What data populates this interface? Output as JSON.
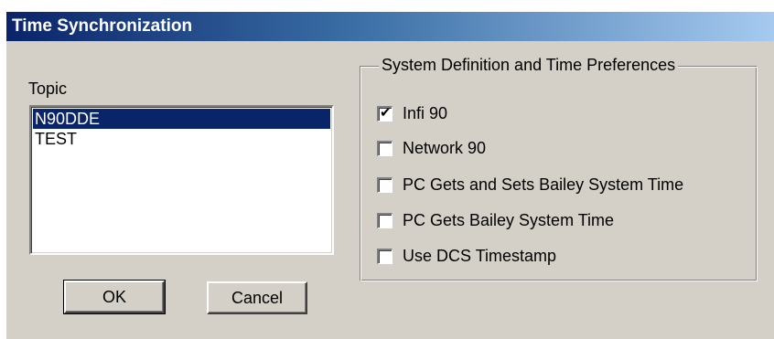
{
  "window": {
    "title": "Time Synchronization"
  },
  "topic": {
    "label": "Topic",
    "items": [
      {
        "label": "N90DDE",
        "selected": true
      },
      {
        "label": "TEST",
        "selected": false
      }
    ]
  },
  "buttons": {
    "ok_label": "OK",
    "cancel_label": "Cancel"
  },
  "preferences": {
    "group_label": "System Definition and Time Preferences",
    "options": [
      {
        "label": "Infi 90",
        "checked": true,
        "mark": "✔"
      },
      {
        "label": "Network 90",
        "checked": false,
        "mark": ""
      },
      {
        "label": "PC Gets and Sets Bailey System Time",
        "checked": false,
        "mark": ""
      },
      {
        "label": "PC Gets Bailey System Time",
        "checked": false,
        "mark": ""
      },
      {
        "label": "Use DCS Timestamp",
        "checked": false,
        "mark": ""
      }
    ]
  }
}
